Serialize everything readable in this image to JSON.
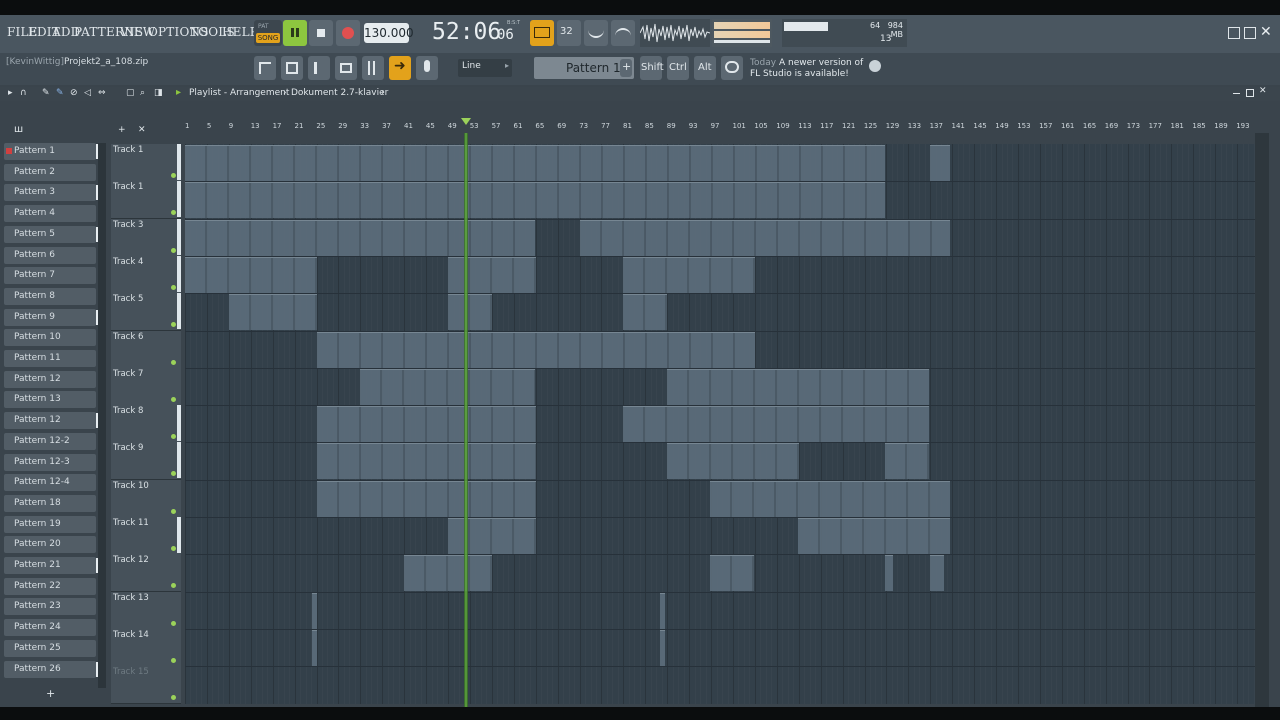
{
  "menu": [
    "FILE",
    "EDIT",
    "ADD",
    "PATTERNS",
    "VIEW",
    "OPTIONS",
    "TOOLS",
    "HELP"
  ],
  "transport": {
    "pat_label": "PAT",
    "song_label": "SONG",
    "tempo": "130.000",
    "time": "52:06",
    "time_sub": "06",
    "time_mode": "B:S:T"
  },
  "mode_label_32": "32",
  "meters": {
    "cpu_value": "64",
    "memory": "984 MB",
    "polyphony": "13"
  },
  "project": {
    "user": "[KevinWittig]",
    "filename": "Projekt2_a_108.zip"
  },
  "snap": "Line",
  "pattern_selector": "Pattern 1",
  "keys": [
    "Shift",
    "Ctrl",
    "Alt"
  ],
  "news": {
    "date": "Today",
    "text_line1": "A newer version of",
    "text_line2": "FL Studio is available!"
  },
  "playlist": {
    "title": "Playlist - Arrangement",
    "breadcrumb_sep": "›",
    "context": "Dokument 2.7-klavier"
  },
  "ruler": [
    "1",
    "5",
    "9",
    "13",
    "17",
    "21",
    "25",
    "29",
    "33",
    "37",
    "41",
    "45",
    "49",
    "53",
    "57",
    "61",
    "65",
    "69",
    "73",
    "77",
    "81",
    "85",
    "89",
    "93",
    "97",
    "101",
    "105",
    "109",
    "113",
    "117",
    "121",
    "125",
    "129",
    "133",
    "137",
    "141",
    "145",
    "149",
    "153",
    "157",
    "161",
    "165",
    "169",
    "173",
    "177",
    "181",
    "185",
    "189",
    "193"
  ],
  "patterns": [
    "Pattern 1",
    "Pattern 2",
    "Pattern 3",
    "Pattern 4",
    "Pattern 5",
    "Pattern 6",
    "Pattern 7",
    "Pattern 8",
    "Pattern 9",
    "Pattern 10",
    "Pattern 11",
    "Pattern 12",
    "Pattern 13",
    "Pattern 12",
    "Pattern 12-2",
    "Pattern 12-3",
    "Pattern 12-4",
    "Pattern 18",
    "Pattern 19",
    "Pattern 20",
    "Pattern 21",
    "Pattern 22",
    "Pattern 23",
    "Pattern 24",
    "Pattern 25",
    "Pattern 26"
  ],
  "tracks": [
    "Track 1",
    "Track 1",
    "Track 3",
    "Track 4",
    "Track 5",
    "Track 6",
    "Track 7",
    "Track 8",
    "Track 9",
    "Track 10",
    "Track 11",
    "Track 12",
    "Track 13",
    "Track 14",
    "Track 15"
  ],
  "add_button": "+"
}
